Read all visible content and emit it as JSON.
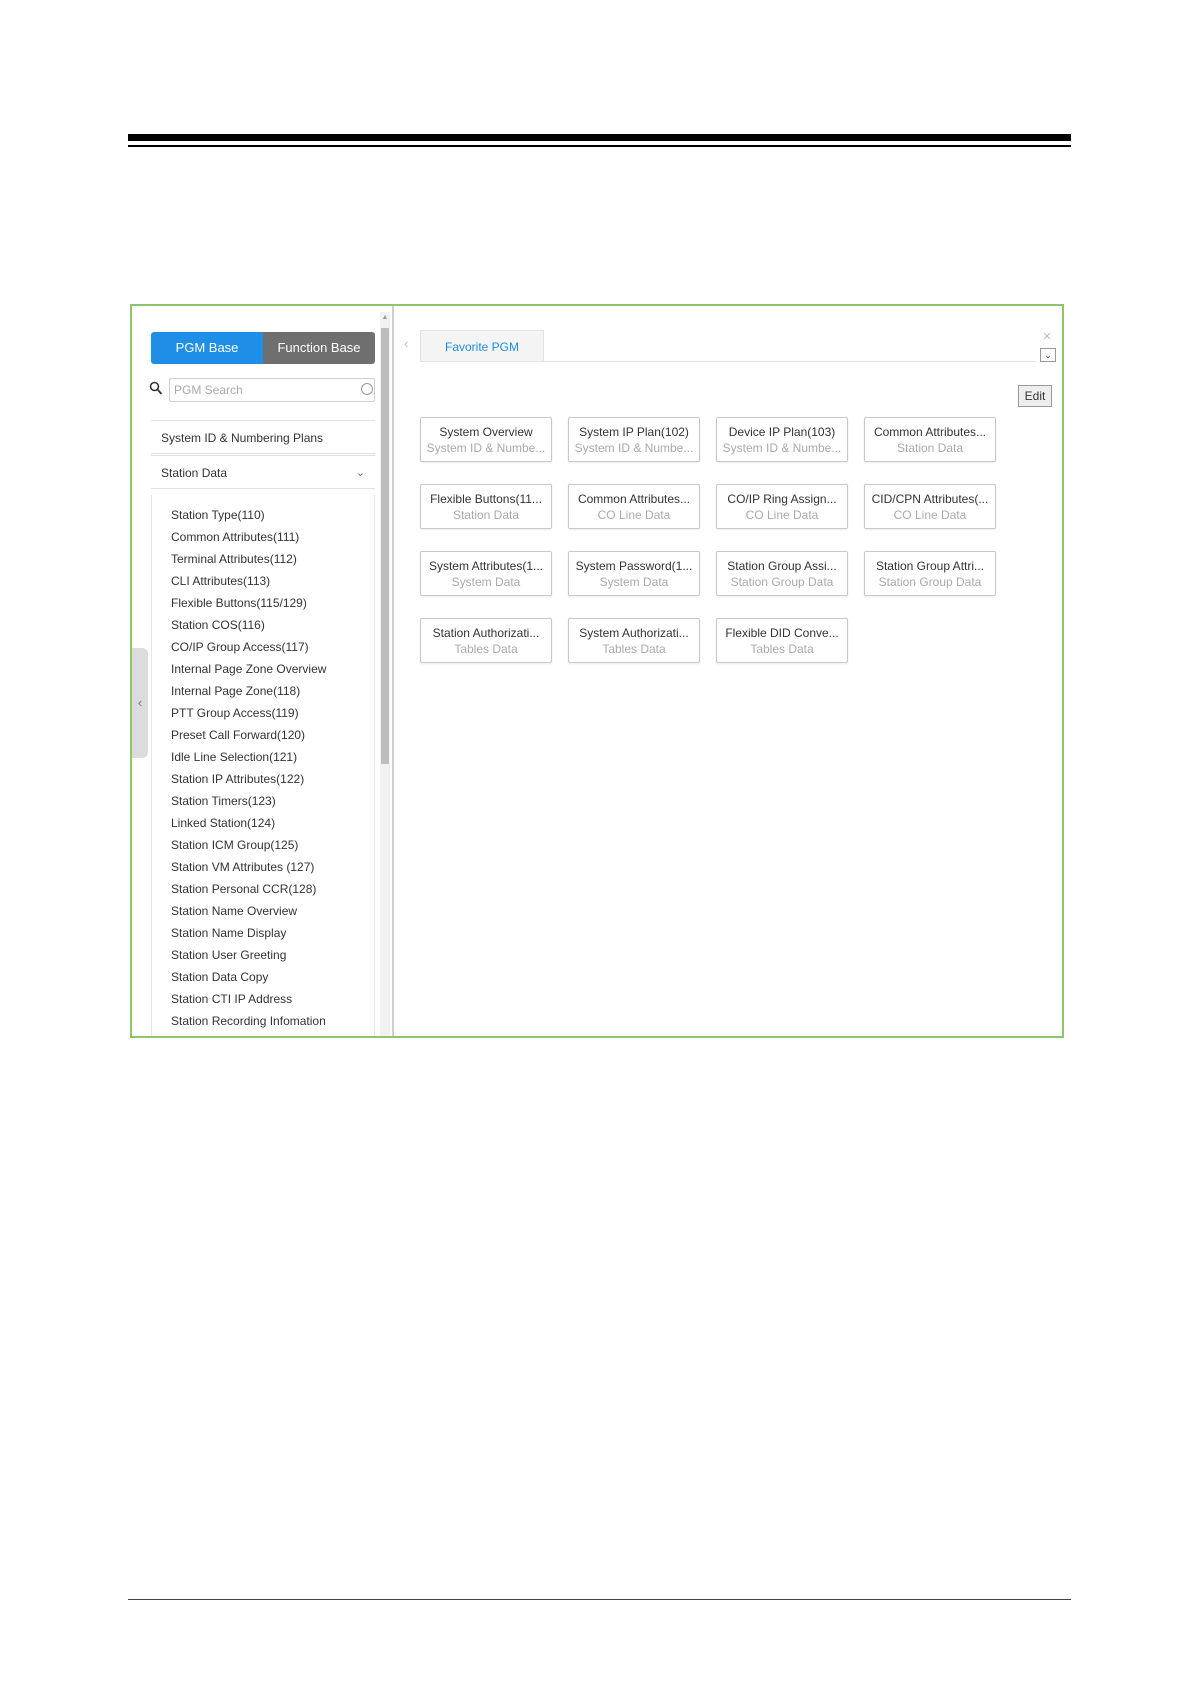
{
  "left_panel": {
    "tabs": [
      {
        "label": "PGM Base",
        "active": true
      },
      {
        "label": "Function Base",
        "active": false
      }
    ],
    "search": {
      "placeholder": "PGM Search",
      "value": ""
    },
    "menu": {
      "system_id_label": "System ID & Numbering Plans",
      "station_data_label": "Station Data",
      "station_data_expanded": true
    },
    "station_items": [
      "Station Type(110)",
      "Common Attributes(111)",
      "Terminal Attributes(112)",
      "CLI Attributes(113)",
      "Flexible Buttons(115/129)",
      "Station COS(116)",
      "CO/IP Group Access(117)",
      "Internal Page Zone Overview",
      "Internal Page Zone(118)",
      "PTT Group Access(119)",
      "Preset Call Forward(120)",
      "Idle Line Selection(121)",
      "Station IP Attributes(122)",
      "Station Timers(123)",
      "Linked Station(124)",
      "Station ICM Group(125)",
      "Station VM Attributes (127)",
      "Station Personal CCR(128)",
      "Station Name Overview",
      "Station Name Display",
      "Station User Greeting",
      "Station Data Copy",
      "Station CTI IP Address",
      "Station Recording Infomation"
    ]
  },
  "right_panel": {
    "tab_label": "Favorite PGM",
    "edit_label": "Edit",
    "cards": [
      {
        "title": "System Overview",
        "category": "System ID & Numbe..."
      },
      {
        "title": "System IP Plan(102)",
        "category": "System ID & Numbe..."
      },
      {
        "title": "Device IP Plan(103)",
        "category": "System ID & Numbe..."
      },
      {
        "title": "Common Attributes...",
        "category": "Station Data"
      },
      {
        "title": "Flexible Buttons(11...",
        "category": "Station Data"
      },
      {
        "title": "Common Attributes...",
        "category": "CO Line Data"
      },
      {
        "title": "CO/IP Ring Assign...",
        "category": "CO Line Data"
      },
      {
        "title": "CID/CPN Attributes(...",
        "category": "CO Line Data"
      },
      {
        "title": "System Attributes(1...",
        "category": "System Data"
      },
      {
        "title": "System Password(1...",
        "category": "System Data"
      },
      {
        "title": "Station Group Assi...",
        "category": "Station Group Data"
      },
      {
        "title": "Station Group Attri...",
        "category": "Station Group Data"
      },
      {
        "title": "Station Authorizati...",
        "category": "Tables Data"
      },
      {
        "title": "System Authorizati...",
        "category": "Tables Data"
      },
      {
        "title": "Flexible DID Conve...",
        "category": "Tables Data"
      }
    ]
  },
  "colors": {
    "accent": "#1f8ee6",
    "frame_border": "#8cc56a",
    "inactive_tab": "#6f6f6f"
  }
}
